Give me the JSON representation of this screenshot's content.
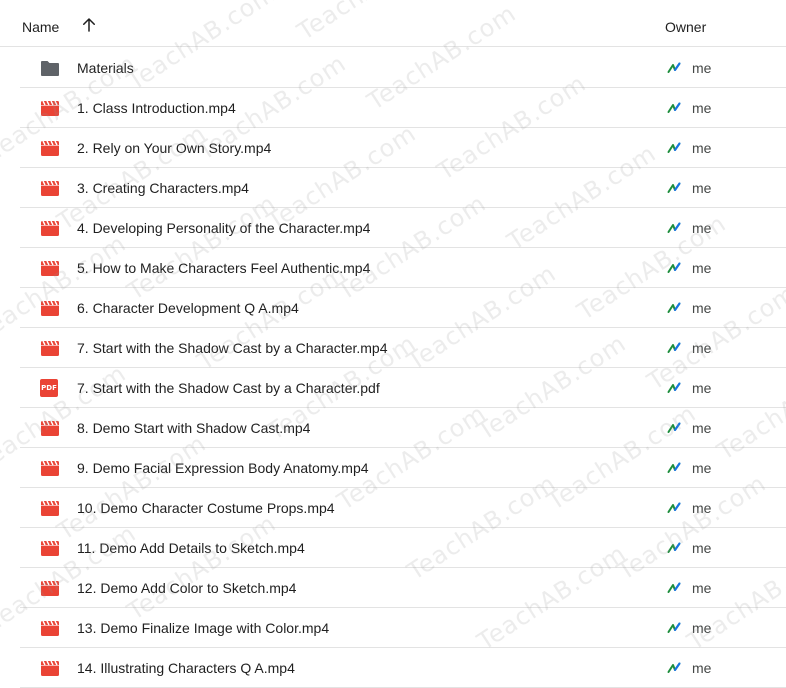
{
  "header": {
    "name_label": "Name",
    "owner_label": "Owner",
    "sort_icon": "arrow-up-icon"
  },
  "rows": [
    {
      "name": "Materials",
      "type": "folder",
      "owner": "me"
    },
    {
      "name": "1. Class Introduction.mp4",
      "type": "video",
      "owner": "me"
    },
    {
      "name": "2. Rely on Your Own Story.mp4",
      "type": "video",
      "owner": "me"
    },
    {
      "name": "3. Creating Characters.mp4",
      "type": "video",
      "owner": "me"
    },
    {
      "name": "4. Developing Personality of the Character.mp4",
      "type": "video",
      "owner": "me"
    },
    {
      "name": "5. How to Make Characters Feel Authentic.mp4",
      "type": "video",
      "owner": "me"
    },
    {
      "name": "6. Character Development Q A.mp4",
      "type": "video",
      "owner": "me"
    },
    {
      "name": "7. Start with the Shadow Cast by a Character.mp4",
      "type": "video",
      "owner": "me"
    },
    {
      "name": "7. Start with the Shadow Cast by a Character.pdf",
      "type": "pdf",
      "owner": "me"
    },
    {
      "name": "8. Demo Start with Shadow Cast.mp4",
      "type": "video",
      "owner": "me"
    },
    {
      "name": "9. Demo Facial Expression Body Anatomy.mp4",
      "type": "video",
      "owner": "me"
    },
    {
      "name": "10. Demo Character Costume Props.mp4",
      "type": "video",
      "owner": "me"
    },
    {
      "name": "11. Demo Add Details to Sketch.mp4",
      "type": "video",
      "owner": "me"
    },
    {
      "name": "12. Demo Add Color to Sketch.mp4",
      "type": "video",
      "owner": "me"
    },
    {
      "name": "13. Demo Finalize Image with Color.mp4",
      "type": "video",
      "owner": "me"
    },
    {
      "name": "14. Illustrating Characters Q A.mp4",
      "type": "video",
      "owner": "me"
    }
  ],
  "pdf_icon_label": "PDF",
  "watermark": "TeachAB.com",
  "colors": {
    "video_icon": "#ea4335",
    "folder_icon": "#5f6368",
    "owner_icon_green": "#1e8e3e",
    "owner_icon_blue": "#1a73e8",
    "divider": "#e3e3e3"
  }
}
